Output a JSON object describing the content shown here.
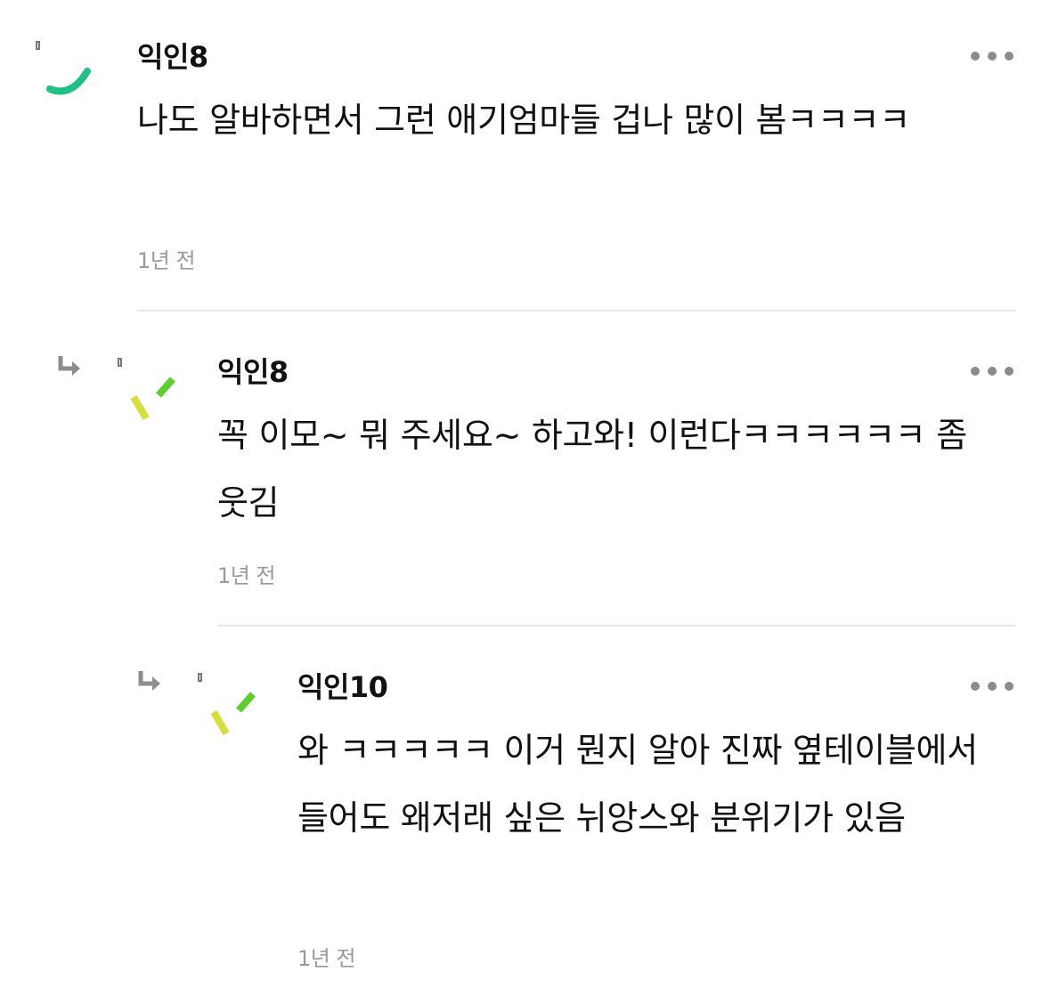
{
  "comments": [
    {
      "author": "익인8",
      "text": "나도 알바하면서 그런 애기엄마들 겁나 많이 봄ㅋㅋㅋㅋ",
      "time": "1년 전",
      "avatar_icon": "green-arc-icon",
      "avatar_color": "#1fbf86"
    },
    {
      "author": "익인8",
      "text": "꼭 이모~ 뭐 주세요~ 하고와! 이런다ㅋㅋㅋㅋㅋㅋ 좀 웃김",
      "time": "1년 전",
      "avatar_icon": "slash-marks-icon",
      "avatar_colors": [
        "#d6df3a",
        "#5fcf2e"
      ]
    },
    {
      "author": "익인10",
      "text": "와 ㅋㅋㅋㅋㅋ 이거 뭔지 알아 진짜 옆테이블에서 들어도 왜저래 싶은 뉘앙스와 분위기가 있음",
      "time": "1년 전",
      "avatar_icon": "slash-marks-icon",
      "avatar_colors": [
        "#d6df3a",
        "#5fcf2e"
      ]
    }
  ]
}
